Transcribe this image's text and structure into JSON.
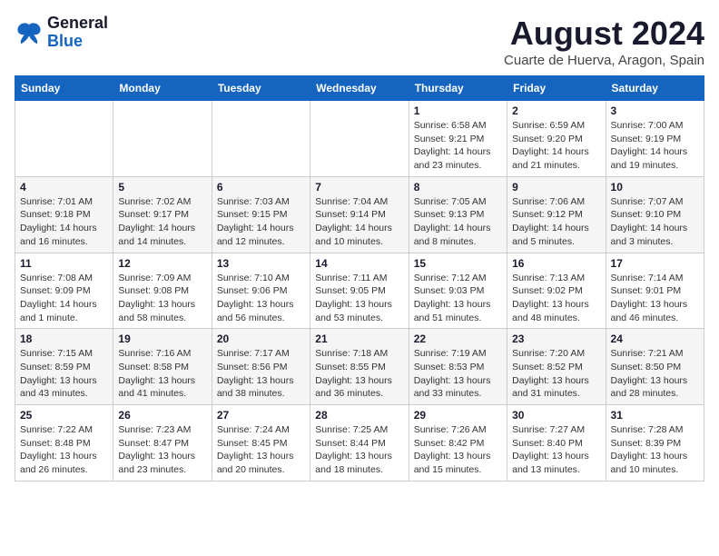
{
  "logo": {
    "line1": "General",
    "line2": "Blue"
  },
  "title": "August 2024",
  "subtitle": "Cuarte de Huerva, Aragon, Spain",
  "weekdays": [
    "Sunday",
    "Monday",
    "Tuesday",
    "Wednesday",
    "Thursday",
    "Friday",
    "Saturday"
  ],
  "weeks": [
    [
      {
        "day": "",
        "info": ""
      },
      {
        "day": "",
        "info": ""
      },
      {
        "day": "",
        "info": ""
      },
      {
        "day": "",
        "info": ""
      },
      {
        "day": "1",
        "info": "Sunrise: 6:58 AM\nSunset: 9:21 PM\nDaylight: 14 hours\nand 23 minutes."
      },
      {
        "day": "2",
        "info": "Sunrise: 6:59 AM\nSunset: 9:20 PM\nDaylight: 14 hours\nand 21 minutes."
      },
      {
        "day": "3",
        "info": "Sunrise: 7:00 AM\nSunset: 9:19 PM\nDaylight: 14 hours\nand 19 minutes."
      }
    ],
    [
      {
        "day": "4",
        "info": "Sunrise: 7:01 AM\nSunset: 9:18 PM\nDaylight: 14 hours\nand 16 minutes."
      },
      {
        "day": "5",
        "info": "Sunrise: 7:02 AM\nSunset: 9:17 PM\nDaylight: 14 hours\nand 14 minutes."
      },
      {
        "day": "6",
        "info": "Sunrise: 7:03 AM\nSunset: 9:15 PM\nDaylight: 14 hours\nand 12 minutes."
      },
      {
        "day": "7",
        "info": "Sunrise: 7:04 AM\nSunset: 9:14 PM\nDaylight: 14 hours\nand 10 minutes."
      },
      {
        "day": "8",
        "info": "Sunrise: 7:05 AM\nSunset: 9:13 PM\nDaylight: 14 hours\nand 8 minutes."
      },
      {
        "day": "9",
        "info": "Sunrise: 7:06 AM\nSunset: 9:12 PM\nDaylight: 14 hours\nand 5 minutes."
      },
      {
        "day": "10",
        "info": "Sunrise: 7:07 AM\nSunset: 9:10 PM\nDaylight: 14 hours\nand 3 minutes."
      }
    ],
    [
      {
        "day": "11",
        "info": "Sunrise: 7:08 AM\nSunset: 9:09 PM\nDaylight: 14 hours\nand 1 minute."
      },
      {
        "day": "12",
        "info": "Sunrise: 7:09 AM\nSunset: 9:08 PM\nDaylight: 13 hours\nand 58 minutes."
      },
      {
        "day": "13",
        "info": "Sunrise: 7:10 AM\nSunset: 9:06 PM\nDaylight: 13 hours\nand 56 minutes."
      },
      {
        "day": "14",
        "info": "Sunrise: 7:11 AM\nSunset: 9:05 PM\nDaylight: 13 hours\nand 53 minutes."
      },
      {
        "day": "15",
        "info": "Sunrise: 7:12 AM\nSunset: 9:03 PM\nDaylight: 13 hours\nand 51 minutes."
      },
      {
        "day": "16",
        "info": "Sunrise: 7:13 AM\nSunset: 9:02 PM\nDaylight: 13 hours\nand 48 minutes."
      },
      {
        "day": "17",
        "info": "Sunrise: 7:14 AM\nSunset: 9:01 PM\nDaylight: 13 hours\nand 46 minutes."
      }
    ],
    [
      {
        "day": "18",
        "info": "Sunrise: 7:15 AM\nSunset: 8:59 PM\nDaylight: 13 hours\nand 43 minutes."
      },
      {
        "day": "19",
        "info": "Sunrise: 7:16 AM\nSunset: 8:58 PM\nDaylight: 13 hours\nand 41 minutes."
      },
      {
        "day": "20",
        "info": "Sunrise: 7:17 AM\nSunset: 8:56 PM\nDaylight: 13 hours\nand 38 minutes."
      },
      {
        "day": "21",
        "info": "Sunrise: 7:18 AM\nSunset: 8:55 PM\nDaylight: 13 hours\nand 36 minutes."
      },
      {
        "day": "22",
        "info": "Sunrise: 7:19 AM\nSunset: 8:53 PM\nDaylight: 13 hours\nand 33 minutes."
      },
      {
        "day": "23",
        "info": "Sunrise: 7:20 AM\nSunset: 8:52 PM\nDaylight: 13 hours\nand 31 minutes."
      },
      {
        "day": "24",
        "info": "Sunrise: 7:21 AM\nSunset: 8:50 PM\nDaylight: 13 hours\nand 28 minutes."
      }
    ],
    [
      {
        "day": "25",
        "info": "Sunrise: 7:22 AM\nSunset: 8:48 PM\nDaylight: 13 hours\nand 26 minutes."
      },
      {
        "day": "26",
        "info": "Sunrise: 7:23 AM\nSunset: 8:47 PM\nDaylight: 13 hours\nand 23 minutes."
      },
      {
        "day": "27",
        "info": "Sunrise: 7:24 AM\nSunset: 8:45 PM\nDaylight: 13 hours\nand 20 minutes."
      },
      {
        "day": "28",
        "info": "Sunrise: 7:25 AM\nSunset: 8:44 PM\nDaylight: 13 hours\nand 18 minutes."
      },
      {
        "day": "29",
        "info": "Sunrise: 7:26 AM\nSunset: 8:42 PM\nDaylight: 13 hours\nand 15 minutes."
      },
      {
        "day": "30",
        "info": "Sunrise: 7:27 AM\nSunset: 8:40 PM\nDaylight: 13 hours\nand 13 minutes."
      },
      {
        "day": "31",
        "info": "Sunrise: 7:28 AM\nSunset: 8:39 PM\nDaylight: 13 hours\nand 10 minutes."
      }
    ]
  ]
}
